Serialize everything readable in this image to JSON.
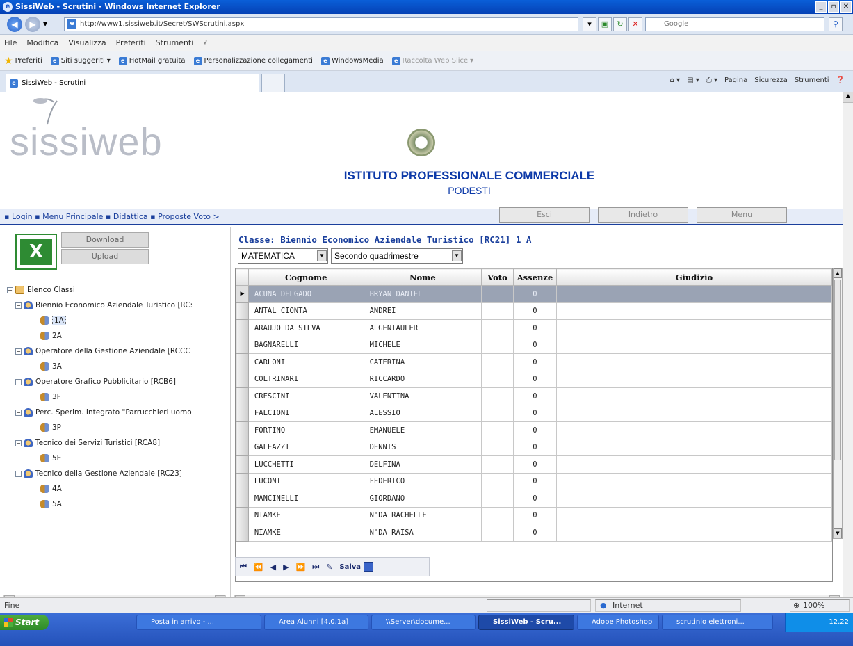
{
  "window": {
    "title": "SissiWeb - Scrutini - Windows Internet Explorer"
  },
  "address": {
    "url": "http://www1.sissiweb.it/Secret/SWScrutini.aspx",
    "search_placeholder": "Google"
  },
  "menu": [
    "File",
    "Modifica",
    "Visualizza",
    "Preferiti",
    "Strumenti",
    "?"
  ],
  "favorites": {
    "label": "Preferiti",
    "items": [
      "Siti suggeriti",
      "HotMail gratuita",
      "Personalizzazione collegamenti",
      "WindowsMedia",
      "Raccolta Web Slice"
    ]
  },
  "tab": {
    "label": "SissiWeb - Scrutini"
  },
  "command_bar": [
    "Pagina",
    "Sicurezza",
    "Strumenti"
  ],
  "site": {
    "logo": "sissiweb",
    "school_name": "ISTITUTO PROFESSIONALE COMMERCIALE",
    "school_sub": "PODESTI"
  },
  "breadcrumb": {
    "items": [
      "Login",
      "Menu Principale",
      "Didattica",
      "Proposte Voto >"
    ]
  },
  "page_buttons": {
    "esci": "Esci",
    "indietro": "Indietro",
    "menu": "Menu"
  },
  "side_buttons": {
    "download": "Download",
    "upload": "Upload"
  },
  "tree": {
    "root": "Elenco Classi",
    "groups": [
      {
        "label": "Biennio Economico Aziendale Turistico [RC:",
        "classes": [
          "1A",
          "2A"
        ]
      },
      {
        "label": "Operatore della Gestione Aziendale [RCCC",
        "classes": [
          "3A"
        ]
      },
      {
        "label": "Operatore Grafico Pubblicitario [RCB6]",
        "classes": [
          "3F"
        ]
      },
      {
        "label": "Perc. Sperim. Integrato \"Parrucchieri uomo",
        "classes": [
          "3P"
        ]
      },
      {
        "label": "Tecnico dei Servizi Turistici [RCA8]",
        "classes": [
          "5E"
        ]
      },
      {
        "label": "Tecnico della Gestione Aziendale [RC23]",
        "classes": [
          "4A",
          "5A"
        ]
      }
    ]
  },
  "main": {
    "class_title": "Classe: Biennio Economico Aziendale Turistico [RC21] 1 A",
    "subject": "MATEMATICA",
    "period": "Secondo quadrimestre",
    "columns": [
      "Cognome",
      "Nome",
      "Voto",
      "Assenze",
      "Giudizio"
    ],
    "rows": [
      [
        "ACUNA DELGADO",
        "BRYAN DANIEL",
        "",
        "0",
        ""
      ],
      [
        "ANTAL CIONTA",
        "ANDREI",
        "",
        "0",
        ""
      ],
      [
        "ARAUJO DA SILVA",
        "ALGENTAULER",
        "",
        "0",
        ""
      ],
      [
        "BAGNARELLI",
        "MICHELE",
        "",
        "0",
        ""
      ],
      [
        "CARLONI",
        "CATERINA",
        "",
        "0",
        ""
      ],
      [
        "COLTRINARI",
        "RICCARDO",
        "",
        "0",
        ""
      ],
      [
        "CRESCINI",
        "VALENTINA",
        "",
        "0",
        ""
      ],
      [
        "FALCIONI",
        "ALESSIO",
        "",
        "0",
        ""
      ],
      [
        "FORTINO",
        "EMANUELE",
        "",
        "0",
        ""
      ],
      [
        "GALEAZZI",
        "DENNIS",
        "",
        "0",
        ""
      ],
      [
        "LUCCHETTI",
        "DELFINA",
        "",
        "0",
        ""
      ],
      [
        "LUCONI",
        "FEDERICO",
        "",
        "0",
        ""
      ],
      [
        "MANCINELLI",
        "GIORDANO",
        "",
        "0",
        ""
      ],
      [
        "NIAMKE",
        "N'DA RACHELLE",
        "",
        "0",
        ""
      ],
      [
        "NIAMKE",
        "N'DA RAISA",
        "",
        "0",
        ""
      ]
    ],
    "save_label": "Salva"
  },
  "status": {
    "left": "Fine",
    "zone": "Internet",
    "zoom": "100%"
  },
  "taskbar": {
    "start": "Start",
    "items": [
      "Posta in arrivo - ...",
      "Area Alunni [4.0.1a]",
      "\\\\Server\\docume...",
      "SissiWeb - Scru...",
      "Adobe Photoshop",
      "scrutinio elettroni..."
    ],
    "clock": "12.22"
  }
}
